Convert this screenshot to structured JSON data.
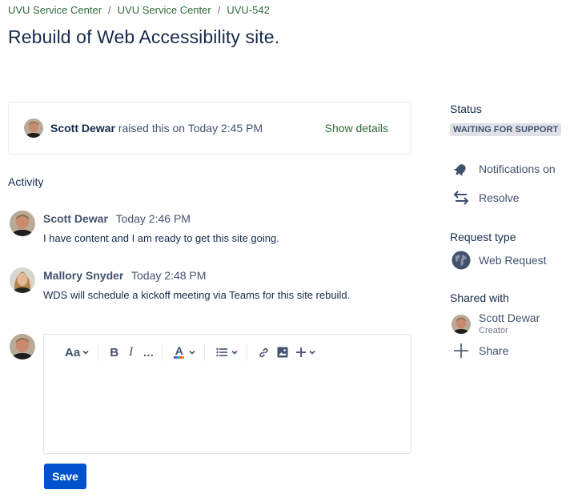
{
  "breadcrumb": {
    "items": [
      "UVU Service Center",
      "UVU Service Center",
      "UVU-542"
    ],
    "separator": "/"
  },
  "page_title": "Rebuild of Web Accessibility site.",
  "raised": {
    "author": "Scott Dewar",
    "text": "raised this on Today 2:45 PM",
    "show_details": "Show details"
  },
  "activity": {
    "heading": "Activity",
    "comments": [
      {
        "author": "Scott Dewar",
        "time": "Today 2:46 PM",
        "text": "I have content and I am ready to get this site going."
      },
      {
        "author": "Mallory Snyder",
        "time": "Today 2:48 PM",
        "text": "WDS will schedule a kickoff meeting via Teams for this site rebuild."
      }
    ]
  },
  "editor": {
    "toolbar": {
      "text_style": "Aa",
      "bold": "B",
      "italic": "I",
      "more": "…",
      "text_color": "A"
    },
    "save_label": "Save"
  },
  "sidebar": {
    "status_label": "Status",
    "status_value": "WAITING FOR SUPPORT",
    "notifications": "Notifications on",
    "resolve": "Resolve",
    "request_type_label": "Request type",
    "request_type_value": "Web Request",
    "shared_with_label": "Shared with",
    "shared_user": {
      "name": "Scott Dewar",
      "role": "Creator"
    },
    "share": "Share"
  },
  "colors": {
    "link_green": "#2e6b3a",
    "primary_blue": "#0052cc",
    "text_dark": "#172b4d",
    "text_subtle": "#42526e",
    "badge_bg": "#dfe1e6"
  }
}
